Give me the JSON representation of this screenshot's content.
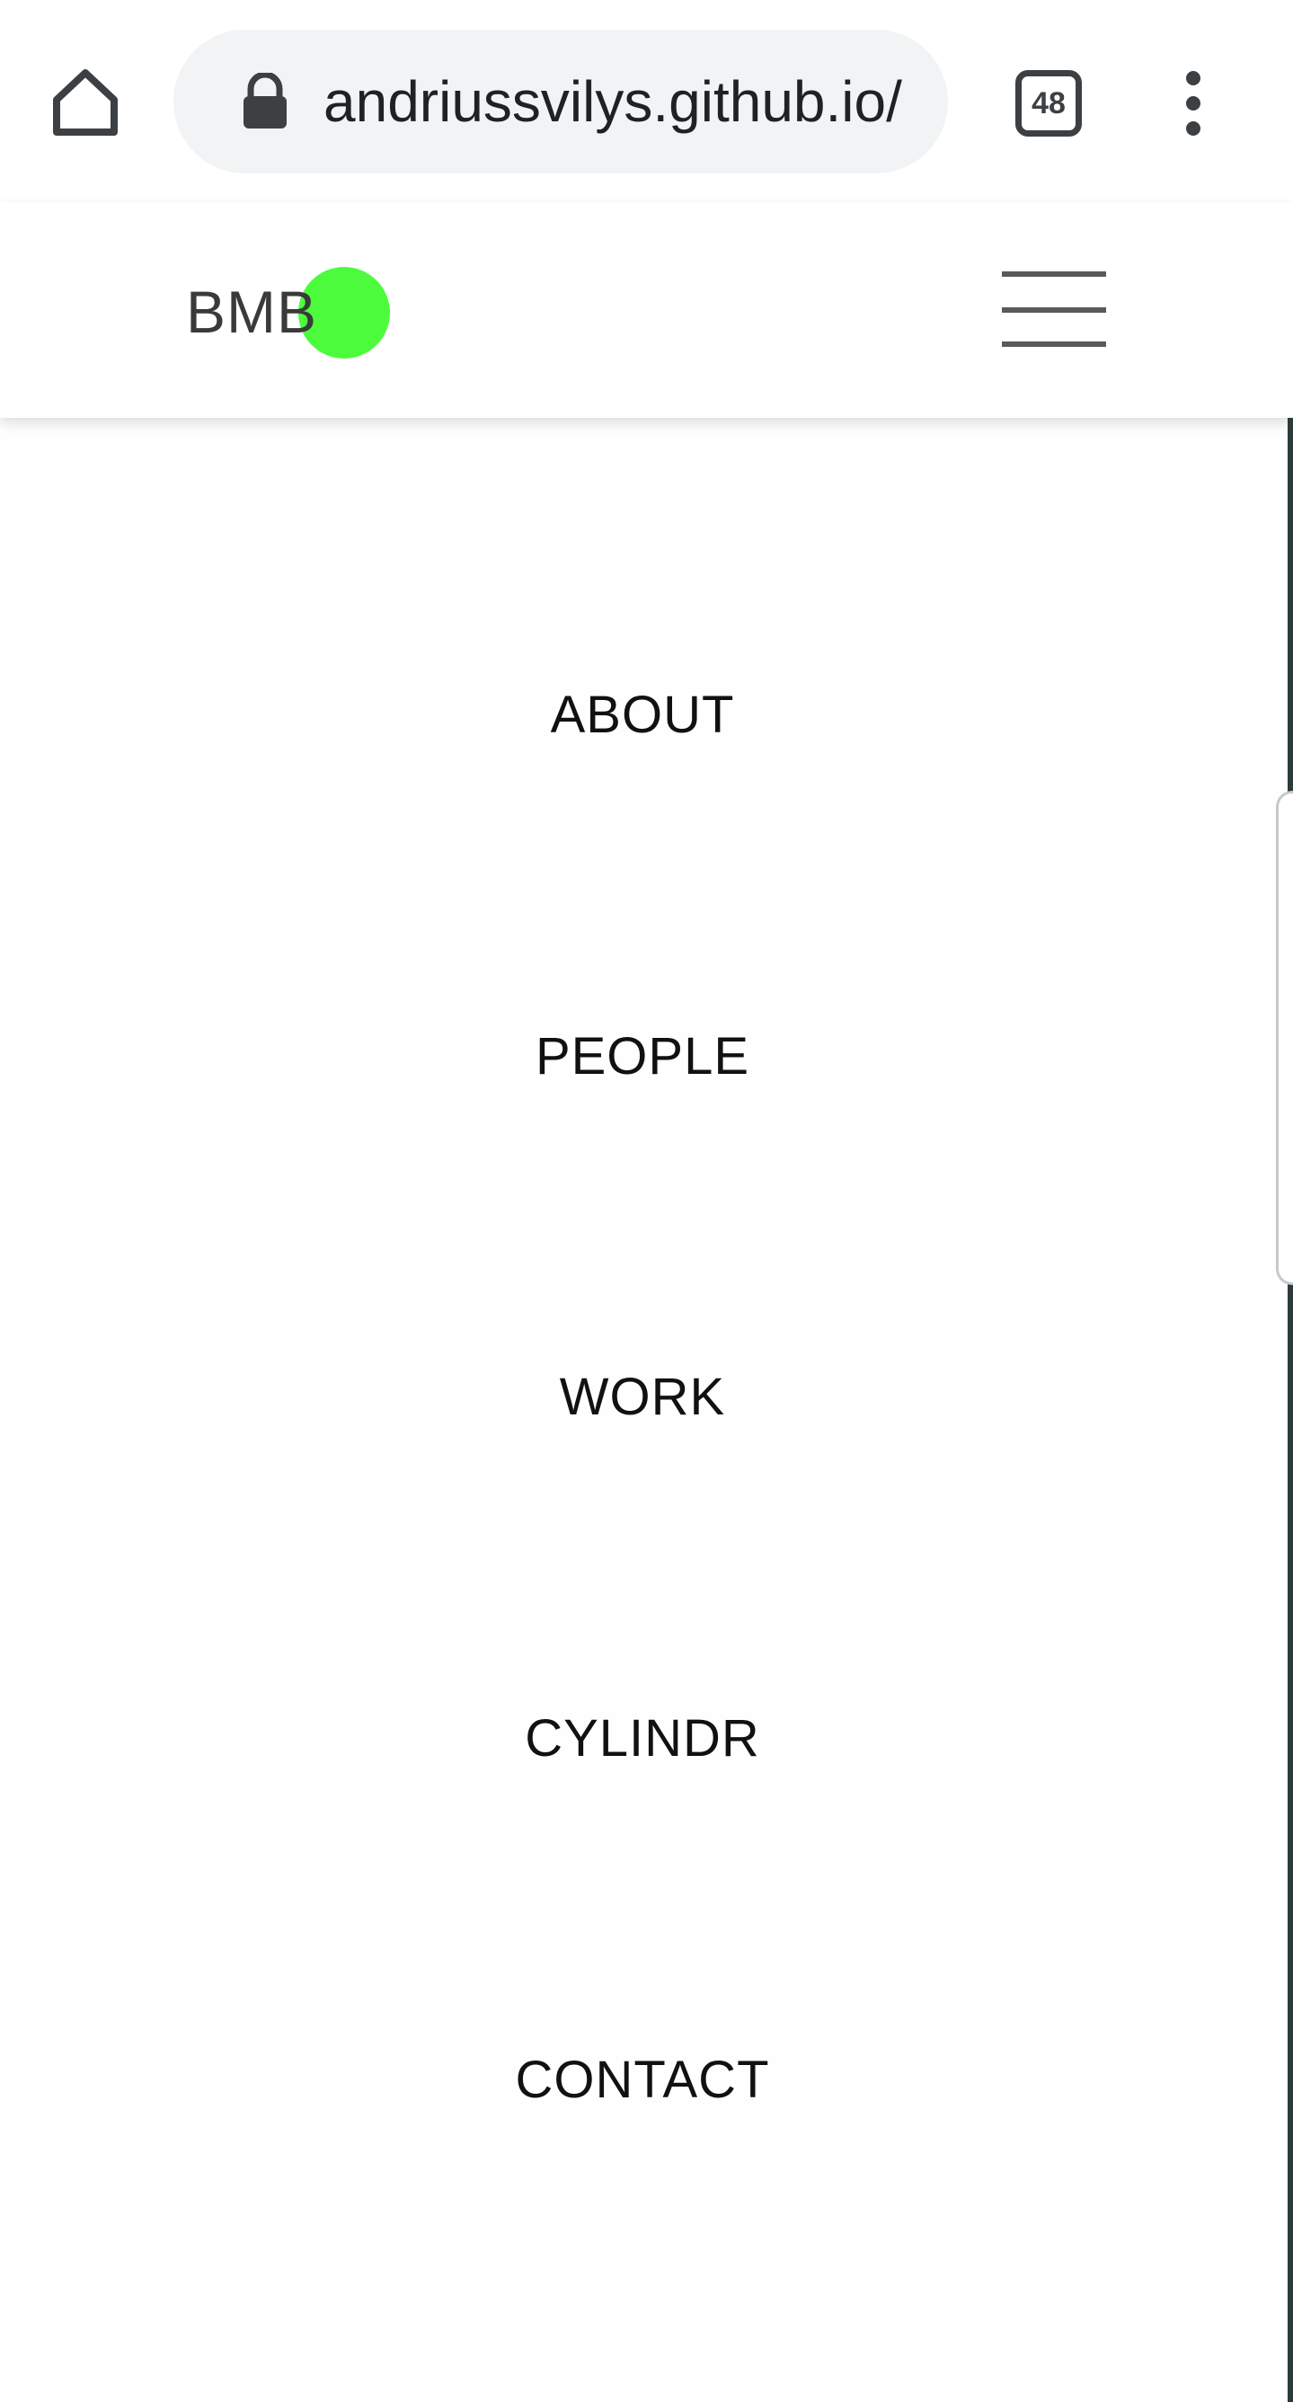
{
  "browser": {
    "url": "andriussvilys.github.io/",
    "tab_count": "48",
    "icons": {
      "home": "home-icon",
      "lock": "lock-icon",
      "tabs": "tab-switcher-icon",
      "menu": "more-vert-icon"
    }
  },
  "header": {
    "logo_text": "BMB",
    "logo_dot_color": "#4cfc3c",
    "menu_icon": "hamburger-icon"
  },
  "nav": {
    "items": [
      {
        "label": "ABOUT"
      },
      {
        "label": "PEOPLE"
      },
      {
        "label": "WORK"
      },
      {
        "label": "CYLINDR"
      },
      {
        "label": "CONTACT"
      }
    ]
  }
}
